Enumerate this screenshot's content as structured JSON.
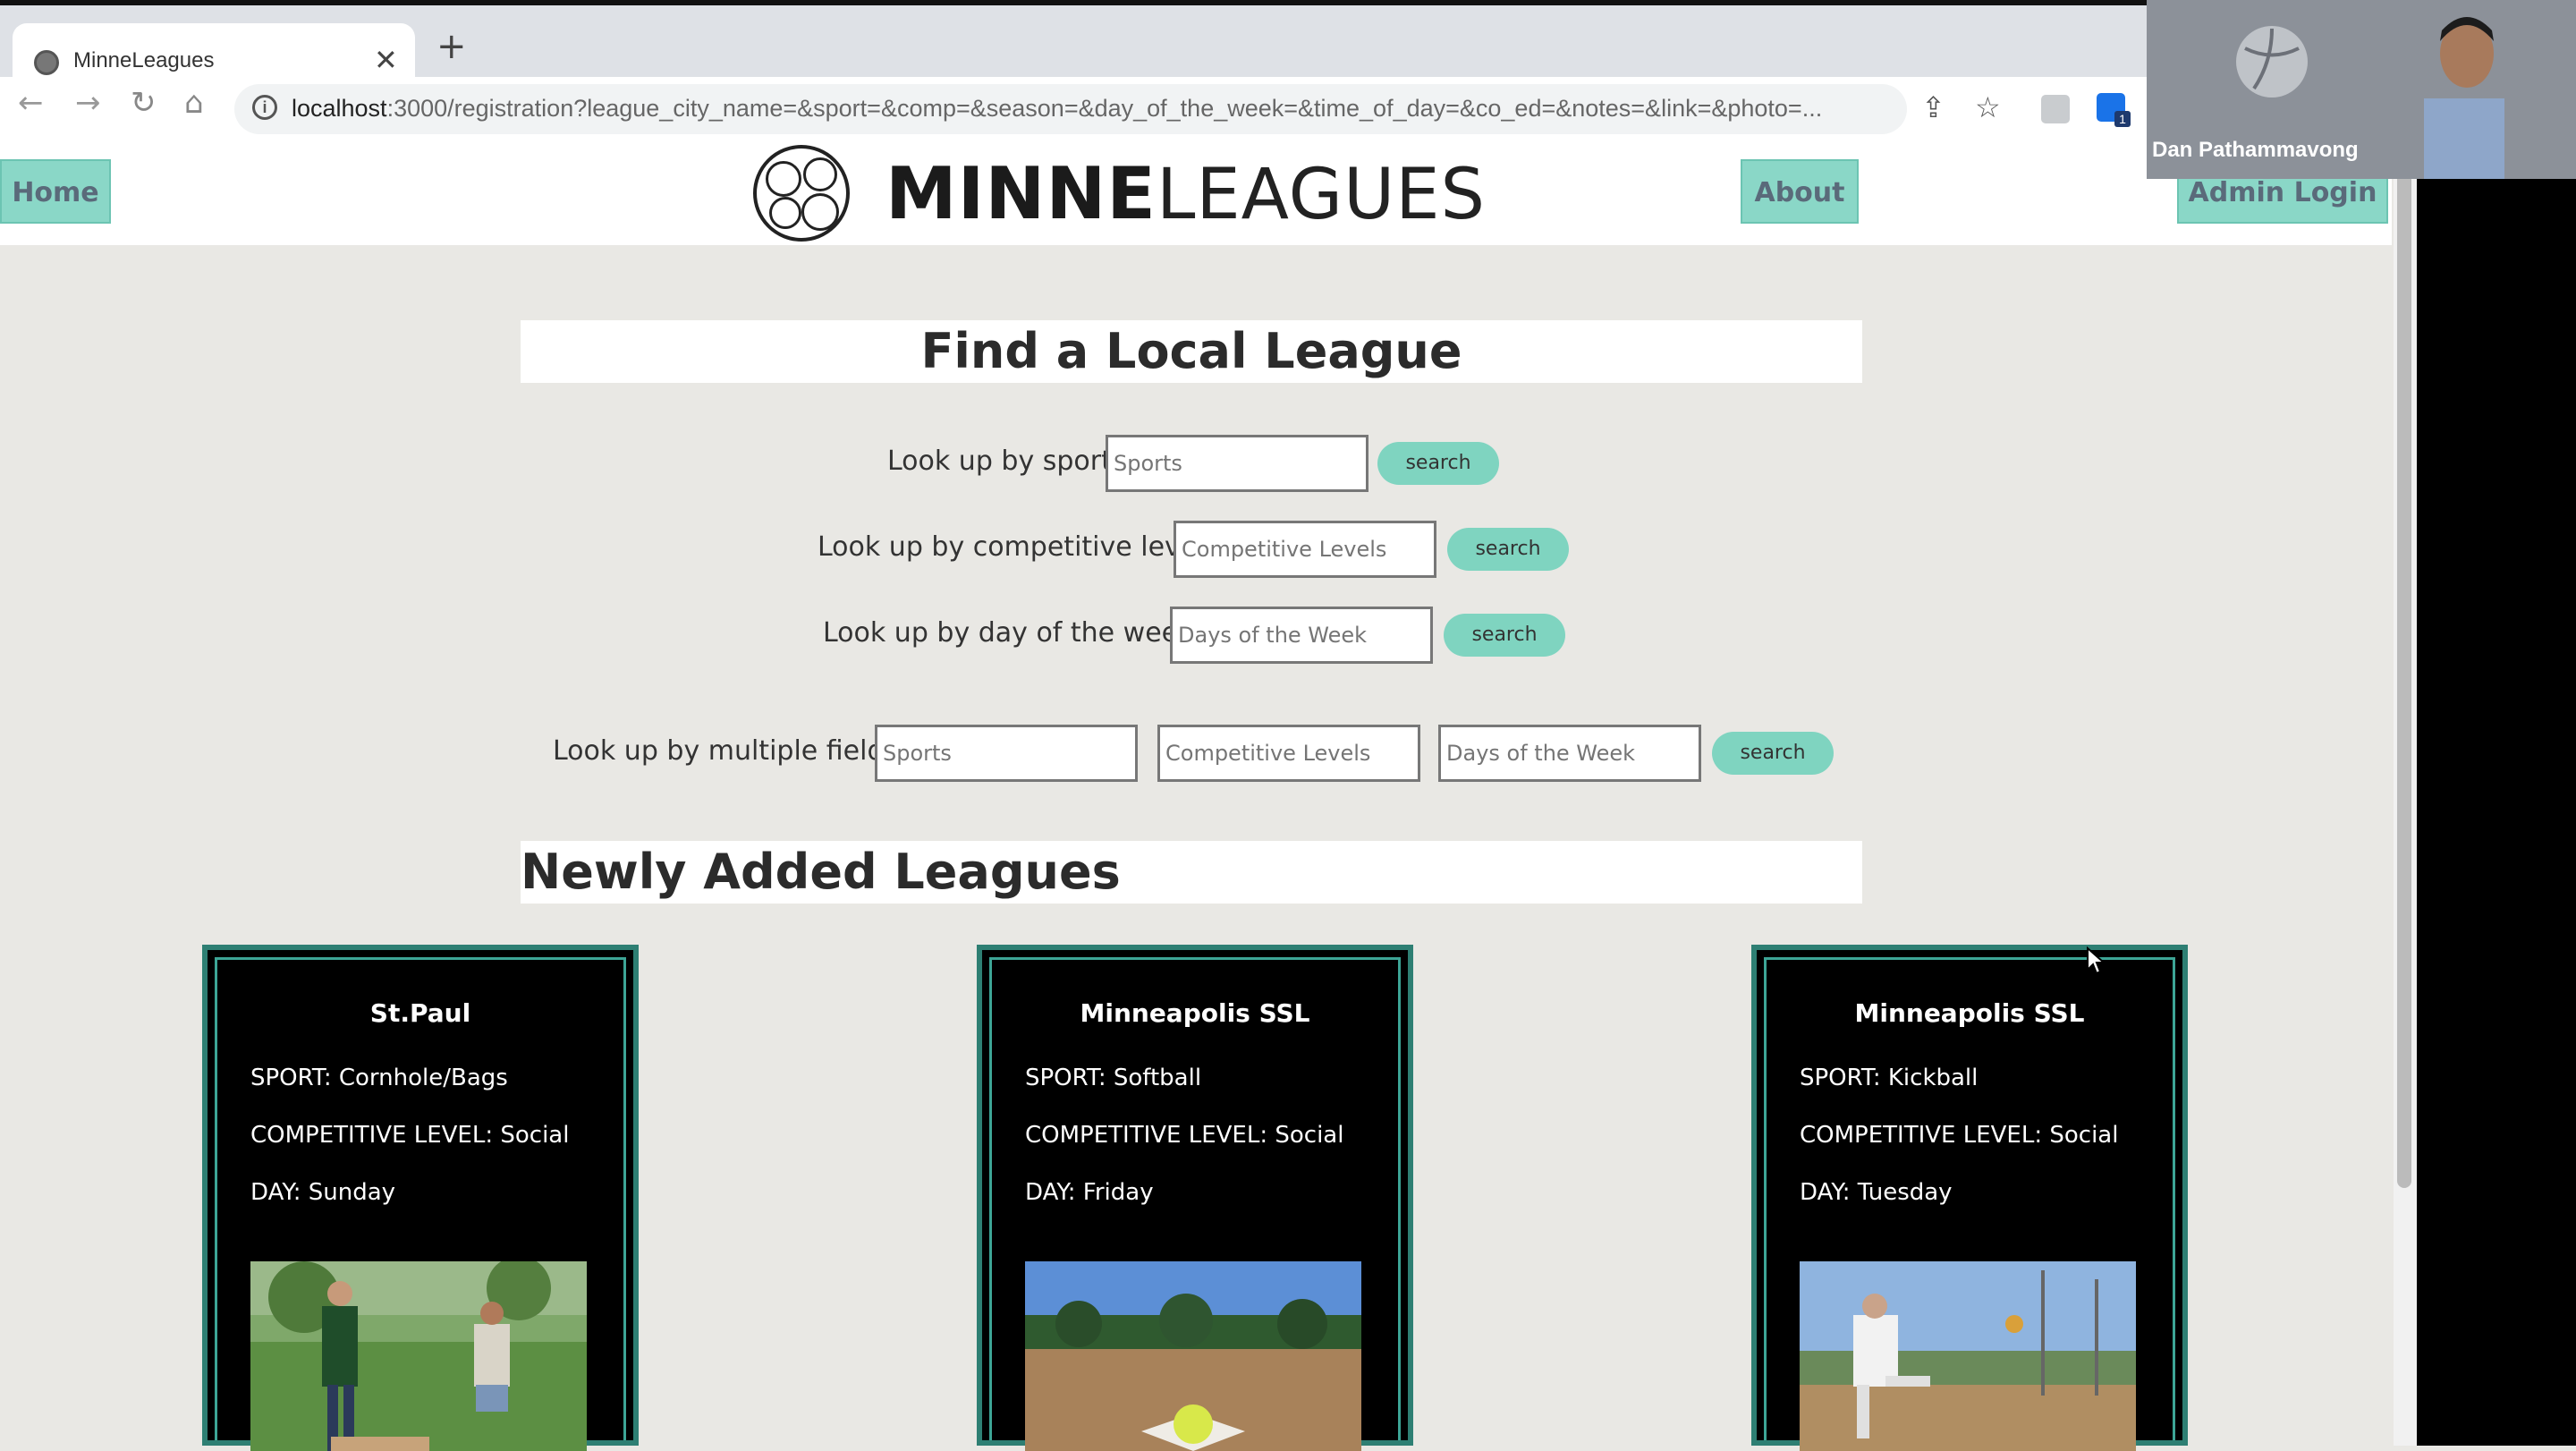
{
  "browser": {
    "tab_title": "MinneLeagues",
    "url_host": "localhost",
    "url_rest": ":3000/registration?league_city_name=&sport=&comp=&season=&day_of_the_week=&time_of_day=&co_ed=&notes=&link=&photo=...",
    "extension_badge": "1"
  },
  "header": {
    "home_label": "Home",
    "logo_bold": "MINNE",
    "logo_light": "LEAGUES",
    "about_label": "About",
    "admin_label": "Admin Login"
  },
  "search": {
    "title": "Find a Local League",
    "sport_label": "Look up by sport:",
    "sport_placeholder": "Sports",
    "comp_label": "Look up by competitive level:",
    "comp_placeholder": "Competitive Levels",
    "day_label": "Look up by day of the week:",
    "day_placeholder": "Days of the Week",
    "multi_label": "Look up by multiple fields:",
    "multi_sport_placeholder": "Sports",
    "multi_comp_placeholder": "Competitive Levels",
    "multi_day_placeholder": "Days of the Week",
    "button_label": "search"
  },
  "newly_added": {
    "title": "Newly Added Leagues",
    "cards": [
      {
        "city": "St.Paul",
        "sport": "SPORT: Cornhole/Bags",
        "level": "COMPETITIVE LEVEL: Social",
        "day": "DAY: Sunday"
      },
      {
        "city": "Minneapolis SSL",
        "sport": "SPORT: Softball",
        "level": "COMPETITIVE LEVEL: Social",
        "day": "DAY: Friday"
      },
      {
        "city": "Minneapolis SSL",
        "sport": "SPORT: Kickball",
        "level": "COMPETITIVE LEVEL: Social",
        "day": "DAY: Tuesday"
      }
    ]
  },
  "video": {
    "participant_name": "Dan Pathammavong"
  },
  "colors": {
    "accent": "#8ad7c7",
    "card_border": "#2e7f73",
    "page_bg": "#e9e8e4"
  }
}
